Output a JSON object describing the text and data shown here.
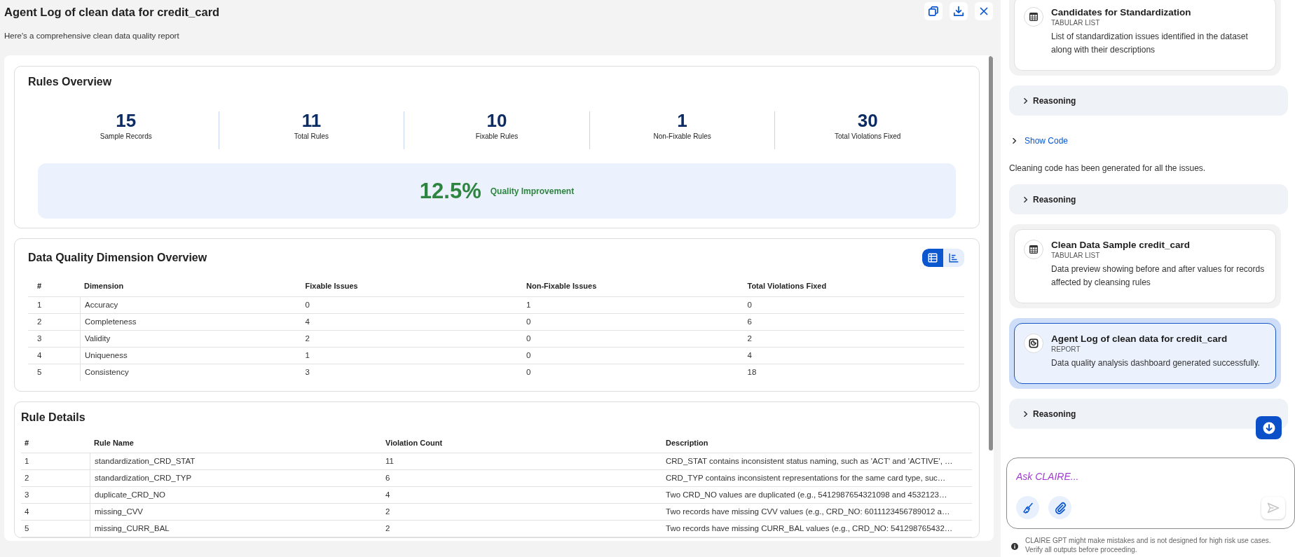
{
  "report": {
    "title": "Agent Log of clean data for credit_card",
    "subtitle": "Here's a comprehensive clean data quality report"
  },
  "rules_overview": {
    "title": "Rules Overview",
    "stats": [
      {
        "value": "15",
        "label": "Sample Records"
      },
      {
        "value": "11",
        "label": "Total Rules"
      },
      {
        "value": "10",
        "label": "Fixable Rules"
      },
      {
        "value": "1",
        "label": "Non-Fixable Rules"
      },
      {
        "value": "30",
        "label": "Total Violations Fixed"
      }
    ],
    "improvement": {
      "value": "12.5%",
      "label": "Quality Improvement"
    }
  },
  "dimension_overview": {
    "title": "Data Quality Dimension Overview",
    "view_toggle": [
      {
        "kind": "table",
        "selected": true
      },
      {
        "kind": "chart",
        "selected": false
      }
    ],
    "table": {
      "columns": [
        "#",
        "Dimension",
        "Fixable Issues",
        "Non-Fixable Issues",
        "Total Violations Fixed"
      ],
      "rows": [
        [
          "1",
          "Accuracy",
          "0",
          "1",
          "0"
        ],
        [
          "2",
          "Completeness",
          "4",
          "0",
          "6"
        ],
        [
          "3",
          "Validity",
          "2",
          "0",
          "2"
        ],
        [
          "4",
          "Uniqueness",
          "1",
          "0",
          "4"
        ],
        [
          "5",
          "Consistency",
          "3",
          "0",
          "18"
        ]
      ]
    }
  },
  "rule_details": {
    "title": "Rule Details",
    "table": {
      "columns": [
        "#",
        "Rule Name",
        "Violation Count",
        "Description"
      ],
      "rows": [
        [
          "1",
          "standardization_CRD_STAT",
          "11",
          "CRD_STAT contains inconsistent status naming, such as 'ACT' and 'ACTIVE', …"
        ],
        [
          "2",
          "standardization_CRD_TYP",
          "6",
          "CRD_TYP contains inconsistent representations for the same card type, suc…"
        ],
        [
          "3",
          "duplicate_CRD_NO",
          "4",
          "Two CRD_NO values are duplicated (e.g., 5412987654321098 and 4532123…"
        ],
        [
          "4",
          "missing_CVV",
          "2",
          "Two records have missing CVV values (e.g., CRD_NO: 6011123456789012 a…"
        ],
        [
          "5",
          "missing_CURR_BAL",
          "2",
          "Two records have missing CURR_BAL values (e.g., CRD_NO: 541298765432…"
        ]
      ]
    }
  },
  "assistant_panel": {
    "items": [
      {
        "kind": "table",
        "title": "Candidates for Standardization",
        "type": "TABULAR LIST",
        "description": "List of standardization issues identified in the dataset along with their descriptions",
        "selected": false
      },
      {
        "kind": "reasoning",
        "label": "Reasoning",
        "expanded": false
      },
      {
        "kind": "code",
        "label": "Show Code",
        "expanded": false
      },
      {
        "kind": "message",
        "text": "Cleaning code has been generated for all the issues."
      },
      {
        "kind": "reasoning",
        "label": "Reasoning",
        "expanded": false
      },
      {
        "kind": "table",
        "title": "Clean Data Sample credit_card",
        "type": "TABULAR LIST",
        "description": "Data preview showing before and after values for records affected by cleansing rules",
        "selected": false
      },
      {
        "kind": "report",
        "title": "Agent Log of clean data for credit_card",
        "type": "REPORT",
        "description": "Data quality analysis dashboard generated successfully.",
        "selected": true
      },
      {
        "kind": "reasoning",
        "label": "Reasoning",
        "expanded": false
      }
    ]
  },
  "composer": {
    "placeholder": "Ask CLAIRE...",
    "disclaimer": "CLAIRE GPT might make mistakes and is not designed for high risk use cases. Verify all outputs before proceeding."
  }
}
